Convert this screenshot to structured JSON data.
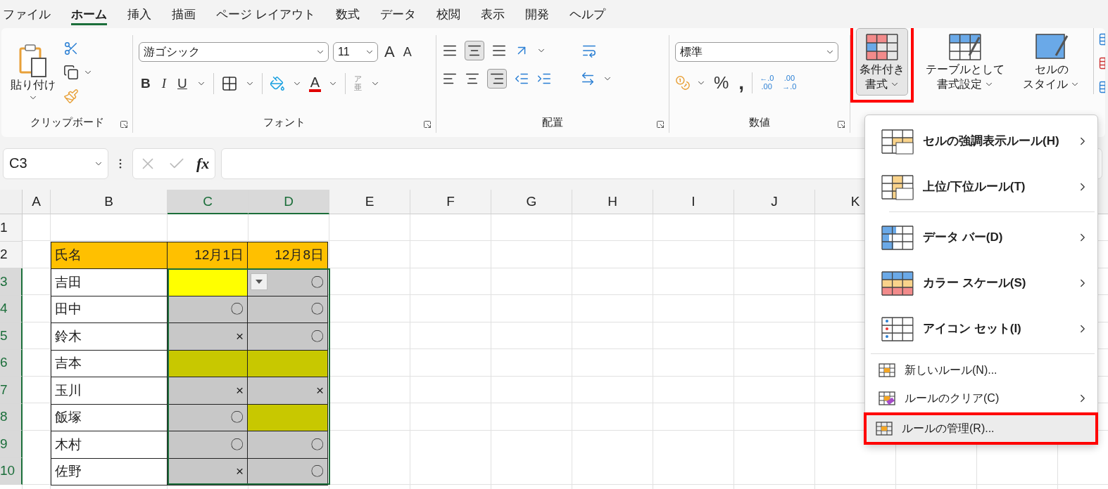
{
  "ribbon": {
    "tabs": [
      {
        "label": "ファイル",
        "selected": false
      },
      {
        "label": "ホーム",
        "selected": true
      },
      {
        "label": "挿入",
        "selected": false
      },
      {
        "label": "描画",
        "selected": false
      },
      {
        "label": "ページ レイアウト",
        "selected": false
      },
      {
        "label": "数式",
        "selected": false
      },
      {
        "label": "データ",
        "selected": false
      },
      {
        "label": "校閲",
        "selected": false
      },
      {
        "label": "表示",
        "selected": false
      },
      {
        "label": "開発",
        "selected": false
      },
      {
        "label": "ヘルプ",
        "selected": false
      }
    ],
    "clipboard": {
      "paste": "貼り付け",
      "label": "クリップボード"
    },
    "font": {
      "name": "游ゴシック",
      "size": "11",
      "grow": "A",
      "shrink": "A",
      "bold": "B",
      "italic": "I",
      "underline": "U",
      "font_color": "A",
      "phonetic": [
        "ア",
        "亜"
      ],
      "label": "フォント"
    },
    "alignment": {
      "label": "配置"
    },
    "number": {
      "format": "標準",
      "percent": "%",
      "comma": ",",
      "decimals": [
        [
          "←.0",
          ".00"
        ],
        [
          ".00",
          "→.0"
        ]
      ],
      "label": "数値"
    },
    "styles": [
      {
        "kind": "conditional",
        "lines": [
          "条件付き",
          "書式"
        ],
        "open": true,
        "annotated": true
      },
      {
        "kind": "table",
        "lines": [
          "テーブルとして",
          "書式設定"
        ],
        "open": false,
        "annotated": false
      },
      {
        "kind": "cell",
        "lines": [
          "セルの",
          "スタイル"
        ],
        "open": false,
        "annotated": false
      }
    ]
  },
  "formula_bar": {
    "name_box": "C3",
    "fx": "fx"
  },
  "sheet": {
    "columns": [
      {
        "label": "A",
        "selected": false
      },
      {
        "label": "B",
        "selected": false
      },
      {
        "label": "C",
        "selected": true
      },
      {
        "label": "D",
        "selected": true
      },
      {
        "label": "E",
        "selected": false
      },
      {
        "label": "F",
        "selected": false
      },
      {
        "label": "G",
        "selected": false
      },
      {
        "label": "H",
        "selected": false
      },
      {
        "label": "I",
        "selected": false
      },
      {
        "label": "J",
        "selected": false
      },
      {
        "label": "K",
        "selected": false
      }
    ],
    "rows": [
      {
        "label": "1",
        "selected": false
      },
      {
        "label": "2",
        "selected": false
      },
      {
        "label": "3",
        "selected": true
      },
      {
        "label": "4",
        "selected": true
      },
      {
        "label": "5",
        "selected": true
      },
      {
        "label": "6",
        "selected": true
      },
      {
        "label": "7",
        "selected": true
      },
      {
        "label": "8",
        "selected": true
      },
      {
        "label": "9",
        "selected": true
      },
      {
        "label": "10",
        "selected": true
      }
    ],
    "table": {
      "header": [
        {
          "text": "氏名",
          "color": "#ffc000"
        },
        {
          "text": "12月1日",
          "color": "#ffc000"
        },
        {
          "text": "12月8日",
          "color": "#ffc000"
        }
      ],
      "rows": [
        {
          "name": "吉田",
          "marks": [
            {
              "color": "#ffff00",
              "dropdown": false
            },
            {
              "text": "〇",
              "color": "#c8c8c8",
              "dropdown": true
            }
          ]
        },
        {
          "name": "田中",
          "marks": [
            {
              "text": "〇",
              "color": "#c8c8c8",
              "dropdown": false
            },
            {
              "text": "〇",
              "color": "#c8c8c8",
              "dropdown": false
            }
          ]
        },
        {
          "name": "鈴木",
          "marks": [
            {
              "text": "×",
              "color": "#c8c8c8",
              "dropdown": false
            },
            {
              "text": "〇",
              "color": "#c8c8c8",
              "dropdown": false
            }
          ]
        },
        {
          "name": "吉本",
          "marks": [
            {
              "color": "#c8c800",
              "dropdown": false
            },
            {
              "color": "#c8c800",
              "dropdown": false
            }
          ]
        },
        {
          "name": "玉川",
          "marks": [
            {
              "text": "×",
              "color": "#c8c8c8",
              "dropdown": false
            },
            {
              "text": "×",
              "color": "#c8c8c8",
              "dropdown": false
            }
          ]
        },
        {
          "name": "飯塚",
          "marks": [
            {
              "text": "〇",
              "color": "#c8c8c8",
              "dropdown": false
            },
            {
              "color": "#c8c800",
              "dropdown": false
            }
          ]
        },
        {
          "name": "木村",
          "marks": [
            {
              "text": "〇",
              "color": "#c8c8c8",
              "dropdown": false
            },
            {
              "text": "〇",
              "color": "#c8c8c8",
              "dropdown": false
            }
          ]
        },
        {
          "name": "佐野",
          "marks": [
            {
              "text": "×",
              "color": "#c8c8c8",
              "dropdown": false
            },
            {
              "text": "〇",
              "color": "#c8c8c8",
              "dropdown": false
            }
          ]
        }
      ]
    }
  },
  "menu": {
    "sections": [
      [
        {
          "kind": "highlight",
          "label": "セルの強調表示ルール(H)",
          "submenu": true,
          "annotated": false
        },
        {
          "kind": "topbottom",
          "label": "上位/下位ルール(T)",
          "submenu": true,
          "annotated": false
        }
      ],
      [
        {
          "kind": "databar",
          "label": "データ バー(D)",
          "submenu": true,
          "annotated": false
        },
        {
          "kind": "colorscale",
          "label": "カラー スケール(S)",
          "submenu": true,
          "annotated": false
        },
        {
          "kind": "iconset",
          "label": "アイコン セット(I)",
          "submenu": true,
          "annotated": false
        }
      ],
      [
        {
          "kind": "new",
          "label": "新しいルール(N)...",
          "submenu": false,
          "annotated": false
        },
        {
          "kind": "clear",
          "label": "ルールのクリア(C)",
          "submenu": true,
          "annotated": false
        },
        {
          "kind": "manage",
          "label": "ルールの管理(R)...",
          "submenu": false,
          "annotated": true
        }
      ]
    ]
  }
}
